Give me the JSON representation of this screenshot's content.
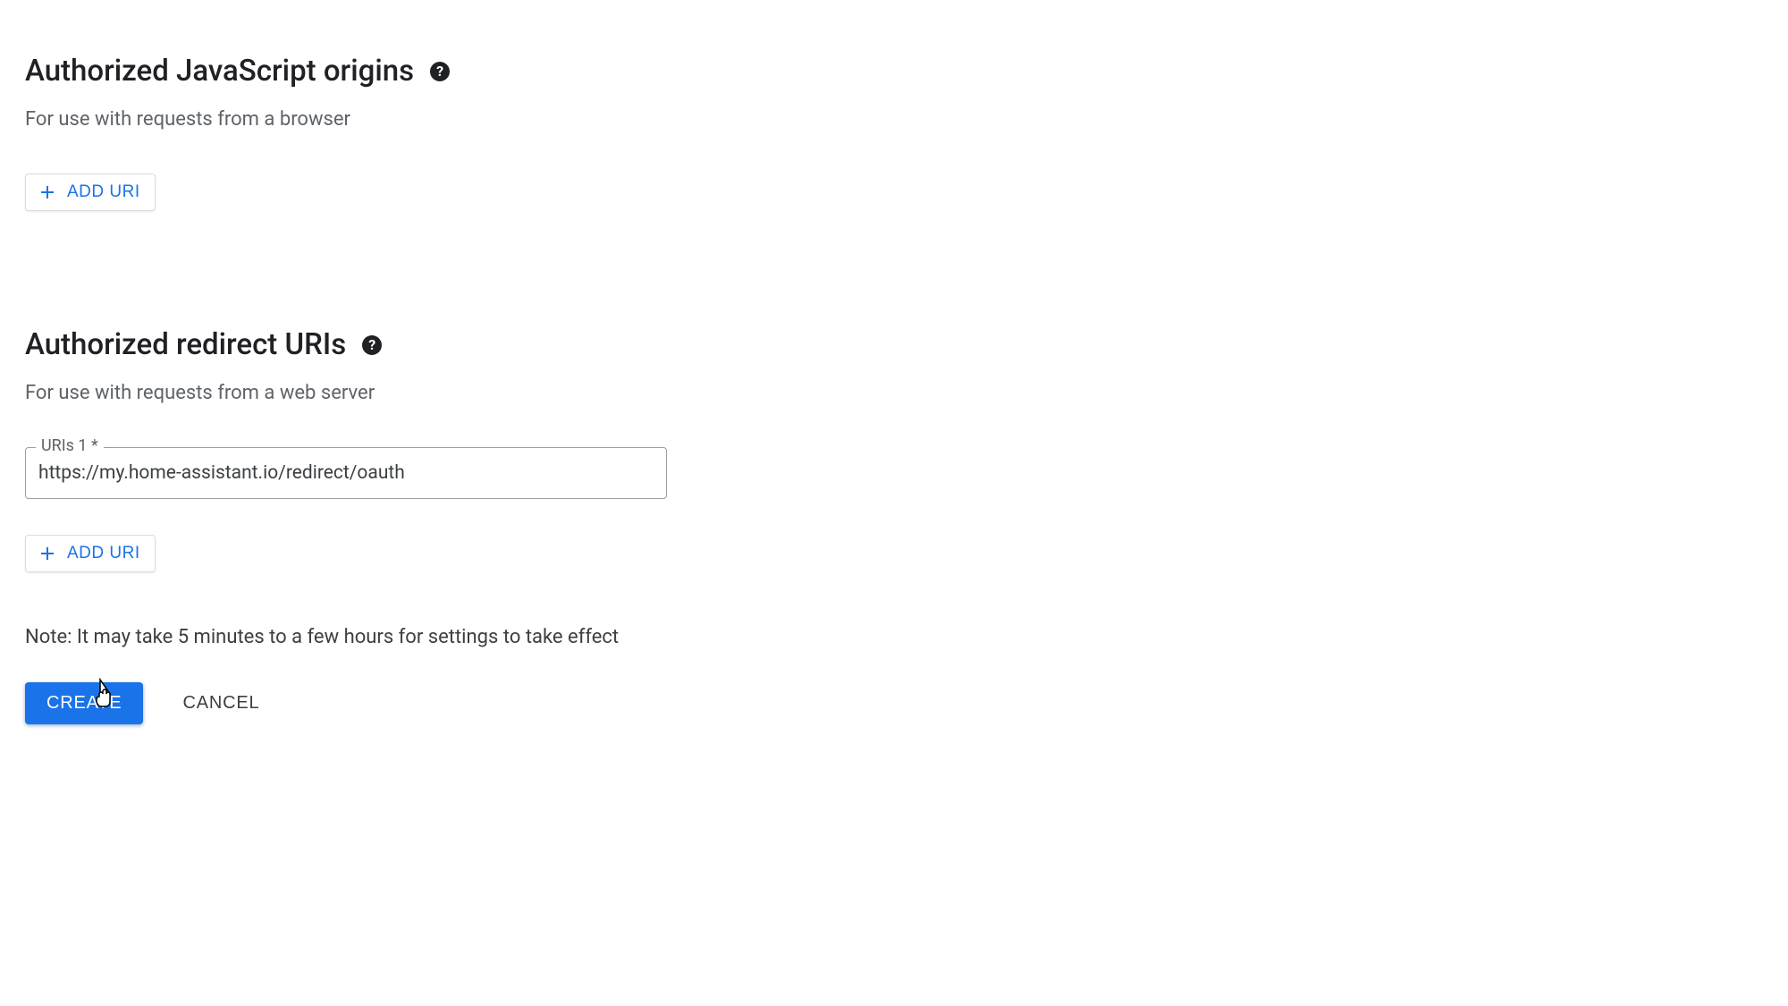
{
  "js_origins": {
    "title": "Authorized JavaScript origins",
    "subtitle": "For use with requests from a browser",
    "add_button_label": "ADD URI"
  },
  "redirect_uris": {
    "title": "Authorized redirect URIs",
    "subtitle": "For use with requests from a web server",
    "input_label": "URIs 1 *",
    "input_value": "https://my.home-assistant.io/redirect/oauth",
    "add_button_label": "ADD URI"
  },
  "note": "Note: It may take 5 minutes to a few hours for settings to take effect",
  "actions": {
    "create_label": "CREATE",
    "cancel_label": "CANCEL"
  }
}
